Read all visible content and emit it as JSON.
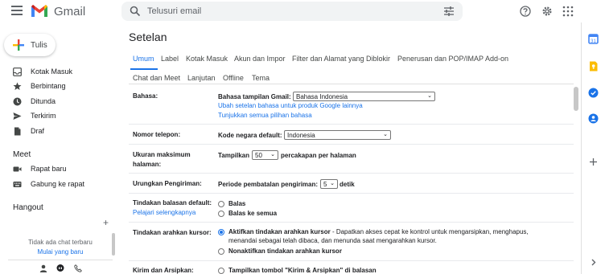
{
  "header": {
    "app_name": "Gmail",
    "search_placeholder": "Telusuri email"
  },
  "sidebar": {
    "compose_label": "Tulis",
    "items": [
      {
        "label": "Kotak Masuk",
        "icon": "inbox-icon"
      },
      {
        "label": "Berbintang",
        "icon": "star-icon"
      },
      {
        "label": "Ditunda",
        "icon": "clock-icon"
      },
      {
        "label": "Terkirim",
        "icon": "send-icon"
      },
      {
        "label": "Draf",
        "icon": "draft-icon"
      }
    ],
    "meet": {
      "title": "Meet",
      "items": [
        {
          "label": "Rapat baru",
          "icon": "video-icon"
        },
        {
          "label": "Gabung ke rapat",
          "icon": "keyboard-icon"
        }
      ]
    },
    "hangout": {
      "title": "Hangout",
      "empty_text": "Tidak ada chat terbaru",
      "start_link": "Mulai yang baru"
    }
  },
  "settings": {
    "title": "Setelan",
    "tabs_row1": [
      "Umum",
      "Label",
      "Kotak Masuk",
      "Akun dan Impor",
      "Filter dan Alamat yang Diblokir",
      "Penerusan dan POP/IMAP",
      "Add-on"
    ],
    "tabs_row2": [
      "Chat dan Meet",
      "Lanjutan",
      "Offline",
      "Tema"
    ],
    "language": {
      "label": "Bahasa:",
      "display_label": "Bahasa tampilan Gmail:",
      "display_value": "Bahasa Indonesia",
      "link_change": "Ubah setelan bahasa untuk produk Google lainnya",
      "link_show_all": "Tunjukkan semua pilihan bahasa"
    },
    "phone": {
      "label": "Nomor telepon:",
      "country_label": "Kode negara default:",
      "country_value": "Indonesia"
    },
    "page_size": {
      "label": "Ukuran maksimum halaman:",
      "prefix": "Tampilkan",
      "value": "50",
      "suffix": "percakapan per halaman"
    },
    "undo_send": {
      "label": "Urungkan Pengiriman:",
      "prefix": "Periode pembatalan pengiriman:",
      "value": "5",
      "suffix": "detik"
    },
    "reply_default": {
      "label": "Tindakan balasan default:",
      "learn_more": "Pelajari selengkapnya",
      "options": [
        "Balas",
        "Balas ke semua"
      ]
    },
    "hover_actions": {
      "label": "Tindakan arahkan kursor:",
      "on_label": "Aktifkan tindakan arahkan kursor",
      "on_desc_1": " - Dapatkan akses cepat ke kontrol untuk mengarsipkan, menghapus,",
      "on_desc_2": "menandai sebagai telah dibaca, dan menunda saat mengarahkan kursor.",
      "off_label": "Nonaktifkan tindakan arahkan kursor"
    },
    "send_archive": {
      "label": "Kirim dan Arsipkan:",
      "option": "Tampilkan tombol \"Kirim & Arsipkan\" di balasan"
    }
  },
  "colors": {
    "accent": "#1a73e8",
    "text": "#202124",
    "muted": "#5f6368"
  }
}
